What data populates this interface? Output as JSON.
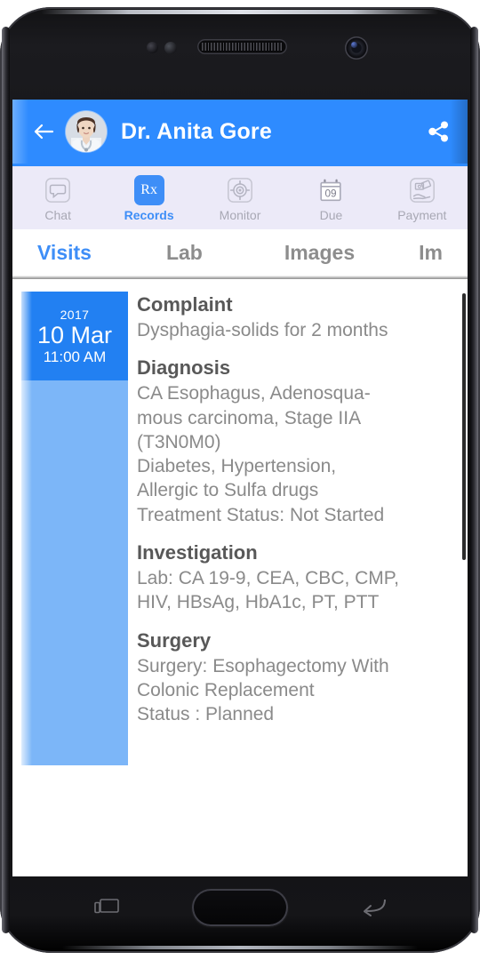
{
  "device": {
    "hardware": {
      "earpiece": "earpiece-speaker",
      "front_camera": "front-camera",
      "proximity_sensor": "proximity-sensor",
      "home_button": "home-button",
      "recents_button": "recents-button",
      "back_button": "back-button"
    }
  },
  "appbar": {
    "back_icon": "back-arrow-icon",
    "avatar": "doctor-avatar",
    "title": "Dr. Anita Gore",
    "share_icon": "share-icon",
    "background_color": "#2e8bff"
  },
  "icon_tabs": [
    {
      "icon": "chat-bubble-icon",
      "label": "Chat",
      "active": false
    },
    {
      "icon": "rx-icon",
      "glyph": "Rx",
      "label": "Records",
      "active": true
    },
    {
      "icon": "monitor-target-icon",
      "label": "Monitor",
      "active": false
    },
    {
      "icon": "calendar-icon",
      "glyph": "09",
      "label": "Due",
      "active": false
    },
    {
      "icon": "payment-hand-icon",
      "label": "Payment",
      "active": false
    }
  ],
  "section_tabs": [
    {
      "label": "Visits",
      "active": true
    },
    {
      "label": "Lab",
      "active": false
    },
    {
      "label": "Images",
      "active": false
    },
    {
      "label": "Im",
      "active": false
    }
  ],
  "visit": {
    "year": "2017",
    "date": "10 Mar",
    "time": "11:00 AM",
    "sections": [
      {
        "title": "Complaint",
        "text": "Dysphagia-solids for 2 months"
      },
      {
        "title": "Diagnosis",
        "text": "CA Esophagus, Adenosqua-\nmous carcinoma, Stage IIA\n(T3N0M0)\nDiabetes, Hypertension,\nAllergic to Sulfa drugs\nTreatment Status: Not Started"
      },
      {
        "title": "Investigation",
        "text": "Lab: CA 19-9, CEA, CBC, CMP,\nHIV, HBsAg, HbA1c, PT, PTT"
      },
      {
        "title": "Surgery",
        "text": "Surgery: Esophagectomy With\nColonic Replacement\nStatus : Planned"
      }
    ]
  },
  "colors": {
    "accent": "#2e8bff",
    "rail_header": "#2280f2",
    "rail_body": "#7cb6f8",
    "tabbar_bg": "#eceaf8",
    "inactive_text": "#a8a8b4"
  }
}
